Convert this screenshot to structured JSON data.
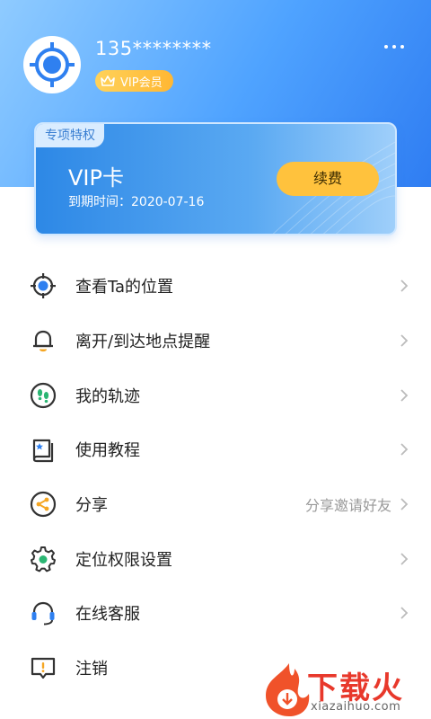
{
  "header": {
    "phone": "135********",
    "vip_badge": "VIP会员"
  },
  "vip_card": {
    "tag": "专项特权",
    "title": "VIP卡",
    "expiry": "到期时间：2020-07-16",
    "renew_label": "续费"
  },
  "menu": {
    "items": [
      {
        "label": "查看Ta的位置",
        "icon": "location-target-icon"
      },
      {
        "label": "离开/到达地点提醒",
        "icon": "bell-icon"
      },
      {
        "label": "我的轨迹",
        "icon": "footprints-icon"
      },
      {
        "label": "使用教程",
        "icon": "book-icon"
      },
      {
        "label": "分享",
        "sub": "分享邀请好友",
        "icon": "share-icon"
      },
      {
        "label": "定位权限设置",
        "icon": "gear-icon"
      },
      {
        "label": "在线客服",
        "icon": "headset-icon"
      },
      {
        "label": "注销",
        "icon": "alert-chat-icon"
      }
    ]
  },
  "watermark": {
    "brand": "下载火",
    "url": "xiazaihuo.com"
  },
  "colors": {
    "accent": "#2f7df2",
    "vip_gold": "#ffc23d",
    "icon_dark": "#3a3a3a",
    "icon_blue": "#2f80f0"
  }
}
